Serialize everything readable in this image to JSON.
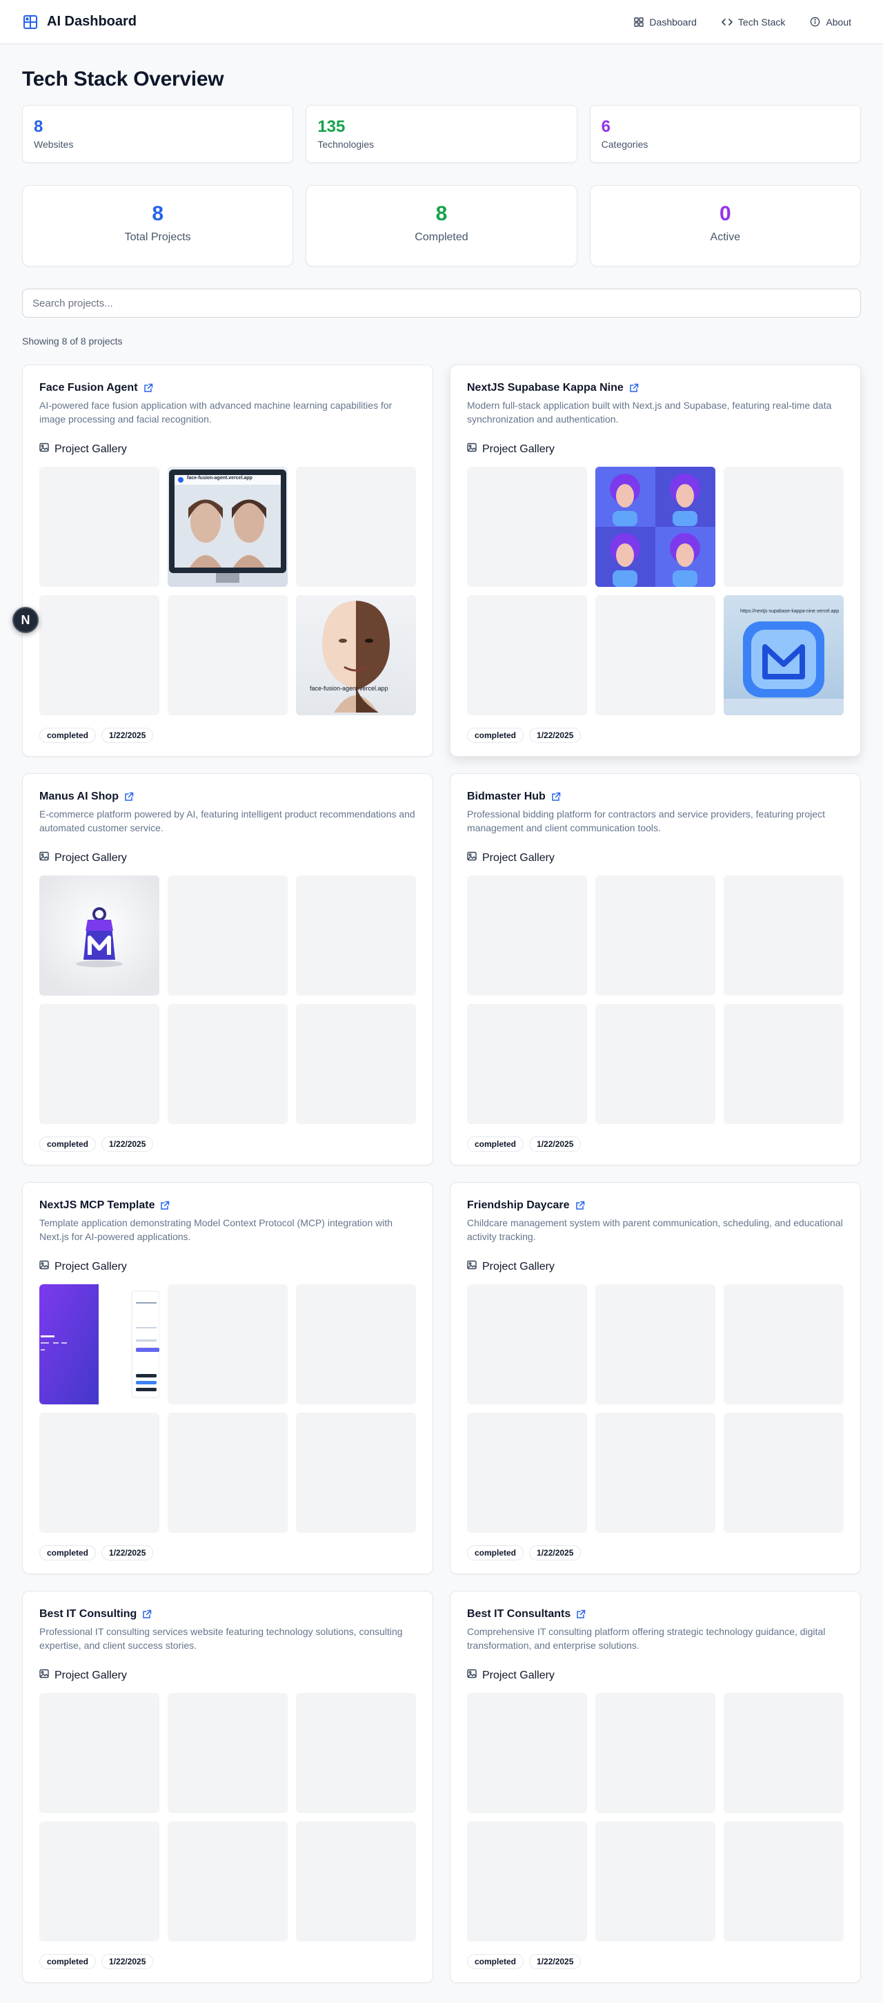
{
  "header": {
    "brand": "AI Dashboard",
    "nav": [
      {
        "label": "Dashboard",
        "icon": "grid-icon"
      },
      {
        "label": "Tech Stack",
        "icon": "code-icon"
      },
      {
        "label": "About",
        "icon": "info-icon"
      }
    ]
  },
  "page_title": "Tech Stack Overview",
  "summary": [
    {
      "value": "8",
      "label": "Websites",
      "color": "#2563eb"
    },
    {
      "value": "135",
      "label": "Technologies",
      "color": "#16a34a"
    },
    {
      "value": "6",
      "label": "Categories",
      "color": "#9333ea"
    }
  ],
  "project_stats": [
    {
      "value": "8",
      "label": "Total Projects",
      "color": "#2563eb"
    },
    {
      "value": "8",
      "label": "Completed",
      "color": "#16a34a"
    },
    {
      "value": "0",
      "label": "Active",
      "color": "#9333ea"
    }
  ],
  "search": {
    "placeholder": "Search projects..."
  },
  "showing": "Showing 8 of 8 projects",
  "gallery_label": "Project Gallery",
  "projects": [
    {
      "title": "Face Fusion Agent",
      "description": "AI-powered face fusion application with advanced machine learning capabilities for image processing and facial recognition.",
      "status": "completed",
      "date": "1/22/2025",
      "image_text": [
        "face-fusion-agent.vercel.app",
        "face-fusion-agent.vercel.app"
      ]
    },
    {
      "title": "NextJS Supabase Kappa Nine",
      "description": "Modern full-stack application built with Next.js and Supabase, featuring real-time data synchronization and authentication.",
      "status": "completed",
      "date": "1/22/2025",
      "image_text": [
        "https://nextjs-supabase-kappa-nine.vercel.app"
      ]
    },
    {
      "title": "Manus AI Shop",
      "description": "E-commerce platform powered by AI, featuring intelligent product recommendations and automated customer service.",
      "status": "completed",
      "date": "1/22/2025"
    },
    {
      "title": "Bidmaster Hub",
      "description": "Professional bidding platform for contractors and service providers, featuring project management and client communication tools.",
      "status": "completed",
      "date": "1/22/2025"
    },
    {
      "title": "NextJS MCP Template",
      "description": "Template application demonstrating Model Context Protocol (MCP) integration with Next.js for AI-powered applications.",
      "status": "completed",
      "date": "1/22/2025"
    },
    {
      "title": "Friendship Daycare",
      "description": "Childcare management system with parent communication, scheduling, and educational activity tracking.",
      "status": "completed",
      "date": "1/22/2025"
    },
    {
      "title": "Best IT Consulting",
      "description": "Professional IT consulting services website featuring technology solutions, consulting expertise, and client success stories.",
      "status": "completed",
      "date": "1/22/2025"
    },
    {
      "title": "Best IT Consultants",
      "description": "Comprehensive IT consulting platform offering strategic technology guidance, digital transformation, and enterprise solutions.",
      "status": "completed",
      "date": "1/22/2025"
    }
  ],
  "floating_badge": "N"
}
